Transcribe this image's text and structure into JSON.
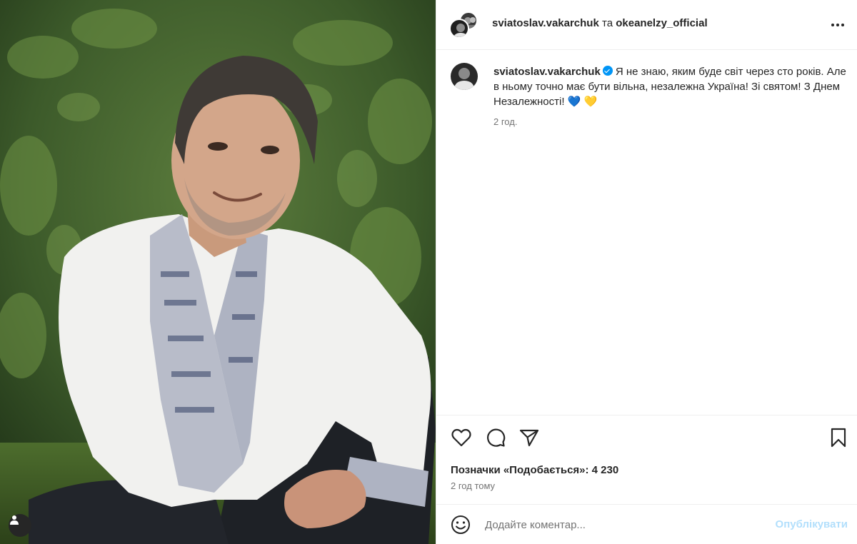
{
  "post": {
    "header": {
      "author": "sviatoslav.vakarchuk",
      "conjunction": "та",
      "coauthor": "okeanelzy_official"
    },
    "caption": {
      "username": "sviatoslav.vakarchuk",
      "text": "Я не знаю, яким буде світ через сто років. Але в ньому точно має бути вільна, незалежна Україна! Зі святом! З Днем Незалежності! 💙 💛",
      "time": "2 год."
    },
    "likes_label": "Позначки «Подобається»: 4 230",
    "posted_ago": "2 год тому",
    "comment": {
      "placeholder": "Додайте коментар...",
      "publish_label": "Опублікувати"
    }
  },
  "icons": [
    "user-tag-icon",
    "more-icon",
    "verified-icon",
    "heart-icon",
    "comment-icon",
    "share-icon",
    "bookmark-icon",
    "emoji-icon"
  ],
  "colors": {
    "accent": "#0095f6",
    "publish_disabled": "#b2dffc",
    "secondary_text": "#737373"
  }
}
